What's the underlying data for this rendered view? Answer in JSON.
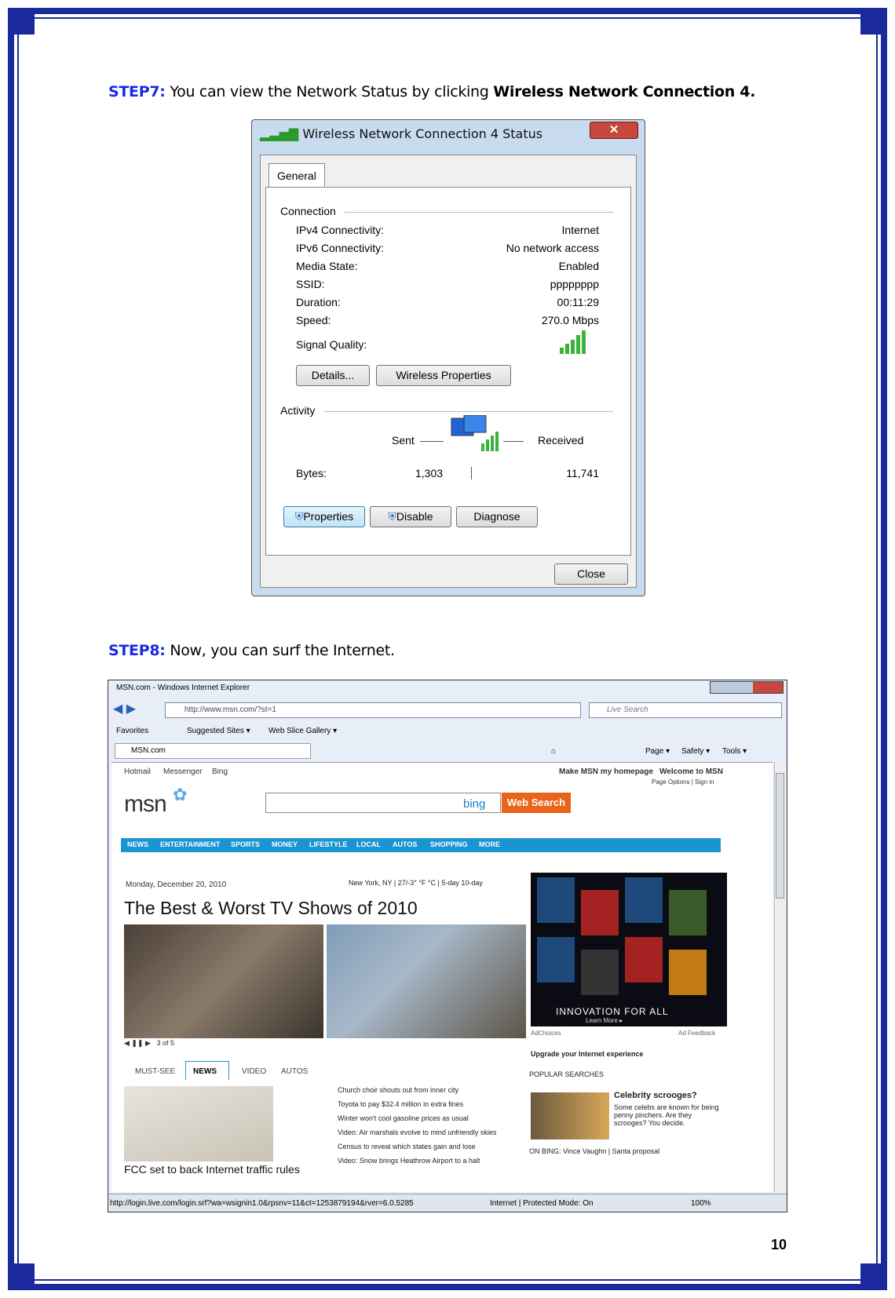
{
  "step7": {
    "label": "STEP7:",
    "text": " You can view the Network Status by clicking ",
    "bold": "Wireless Network Connection 4."
  },
  "step8": {
    "label": "STEP8:",
    "text": " Now, you can surf the Internet."
  },
  "page_number": "10",
  "dialog": {
    "title": "Wireless Network Connection 4 Status",
    "tab": "General",
    "connection_group": "Connection",
    "rows": [
      {
        "label": "IPv4 Connectivity:",
        "value": "Internet"
      },
      {
        "label": "IPv6 Connectivity:",
        "value": "No network access"
      },
      {
        "label": "Media State:",
        "value": "Enabled"
      },
      {
        "label": "SSID:",
        "value": "pppppppp"
      },
      {
        "label": "Duration:",
        "value": "00:11:29"
      },
      {
        "label": "Speed:",
        "value": "270.0 Mbps"
      }
    ],
    "signal_label": "Signal Quality:",
    "details_button": "Details...",
    "wireless_props_button": "Wireless Properties",
    "activity_group": "Activity",
    "sent": "Sent",
    "received": "Received",
    "bytes_label": "Bytes:",
    "bytes_sent": "1,303",
    "bytes_received": "11,741",
    "properties_button": "Properties",
    "disable_button": "Disable",
    "diagnose_button": "Diagnose",
    "close_button": "Close"
  },
  "browser": {
    "title": "MSN.com - Windows Internet Explorer",
    "address": "http://www.msn.com/?st=1",
    "search_placeholder": "Live Search",
    "favorites": "Favorites",
    "suggested": "Suggested Sites ▾",
    "webslice": "Web Slice Gallery ▾",
    "tab": "MSN.com",
    "cmd_page": "Page ▾",
    "cmd_safety": "Safety ▾",
    "cmd_tools": "Tools ▾",
    "status_url": "http://login.live.com/login.srf?wa=wsignin1.0&rpsnv=11&ct=1253879194&rver=6.0.5285",
    "status_zone": "Internet | Protected Mode: On",
    "zoom": "100%"
  },
  "msn": {
    "links": [
      "Hotmail",
      "Messenger",
      "Bing"
    ],
    "make_home": "Make MSN my homepage",
    "welcome": "Welcome to MSN",
    "page_options": "Page Options | Sign in",
    "logo": "msn",
    "bing": "bing",
    "web_search": "Web Search",
    "nav": [
      "NEWS",
      "ENTERTAINMENT",
      "SPORTS",
      "MONEY",
      "LIFESTYLE",
      "LOCAL",
      "AUTOS",
      "SHOPPING",
      "MORE"
    ],
    "date": "Monday, December 20, 2010",
    "weather": "New York, NY | 27/-3°  °F °C | 5-day  10-day",
    "headline": "The Best & Worst TV Shows of 2010",
    "pager": "3 of 5",
    "tabs": [
      "MUST-SEE",
      "NEWS",
      "VIDEO",
      "AUTOS"
    ],
    "caption": "FCC set to back Internet traffic rules",
    "news": [
      "Church choir shouts out from inner city",
      "Toyota to pay $32.4 million in extra fines",
      "Winter won't cool gasoline prices as usual",
      "Video: Air marshals evolve to mind unfriendly skies",
      "Census to reveal which states gain and lose",
      "Video: Snow brings Heathrow Airport to a halt"
    ],
    "ad_tagline": "INNOVATION FOR ALL",
    "ad_sub": "Learn More ▸",
    "adchoices": "AdChoices",
    "ad_feedback": "Ad Feedback",
    "upgrade": "Upgrade your Internet experience",
    "popular": "POPULAR SEARCHES",
    "celeb_title": "Celebrity scrooges?",
    "celeb_text": "Some celebs are known for being penny pinchers. Are they scrooges? You decide.",
    "on_bing": "ON BING: Vince Vaughn | Santa proposal"
  }
}
